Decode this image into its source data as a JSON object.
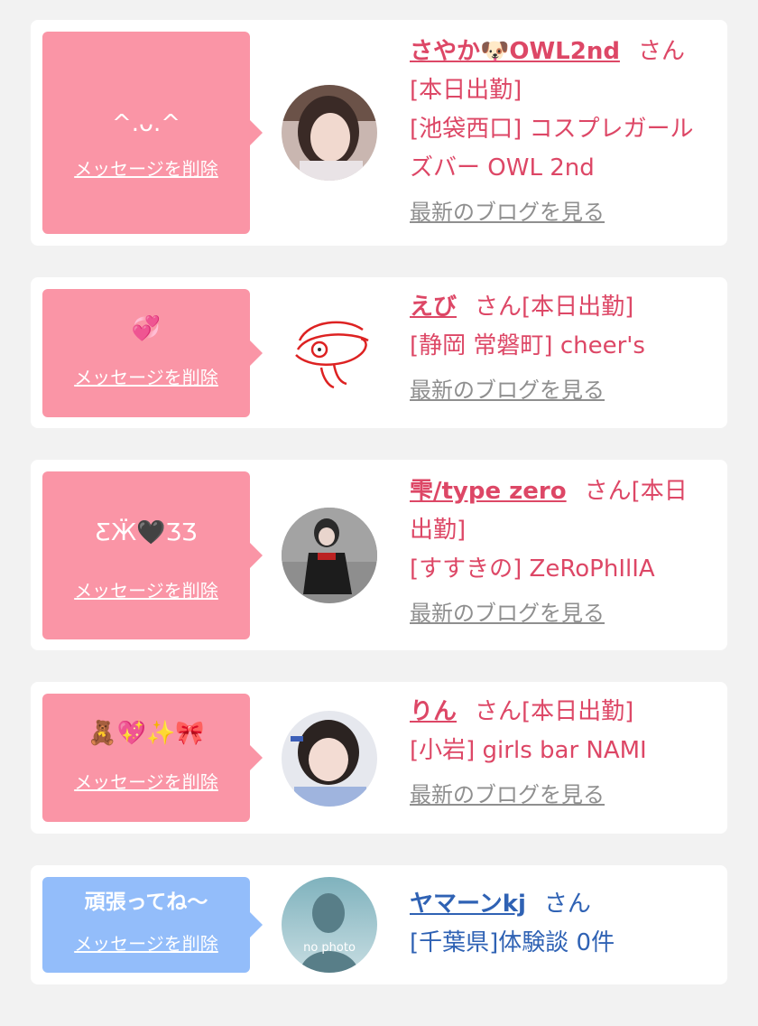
{
  "colors": {
    "pink_bubble": "#fa95a6",
    "blue_bubble": "#93bdfa",
    "pink_text": "#dd4766",
    "blue_text": "#2f62b4",
    "link_gray": "#8f8f8f"
  },
  "cards": [
    {
      "message": "^.ᴗ.^",
      "delete_label": "メッセージを削除",
      "name": "さやか🐶OWL2nd",
      "san": "さん",
      "line1": "[本日出勤]",
      "line2": "[池袋西口] コスプレガール",
      "line3": "ズバー OWL 2nd",
      "blog_link": "最新のブログを見る"
    },
    {
      "message": "💞",
      "delete_label": "メッセージを削除",
      "name": "えび",
      "san": "さん[本日出勤]",
      "line1": "[静岡 常磐町] cheer's",
      "blog_link": "最新のブログを見る"
    },
    {
      "message": "ƸӜ🖤ƷƷ",
      "delete_label": "メッセージを削除",
      "name": "雫/type zero",
      "san": "さん[本日",
      "line1": "出勤]",
      "line2": "[すすきの] ZeRoPhIlIA",
      "blog_link": "最新のブログを見る"
    },
    {
      "message": "🧸💖✨🎀",
      "delete_label": "メッセージを削除",
      "name": "りん",
      "san": "さん[本日出勤]",
      "line1": "[小岩] girls bar NAMI",
      "blog_link": "最新のブログを見る"
    },
    {
      "message": "頑張ってね〜",
      "delete_label": "メッセージを削除",
      "name": "ヤマーンkj",
      "san": "さん",
      "line1": "[千葉県]体験談 0件",
      "avatar_text": "no photo"
    }
  ]
}
